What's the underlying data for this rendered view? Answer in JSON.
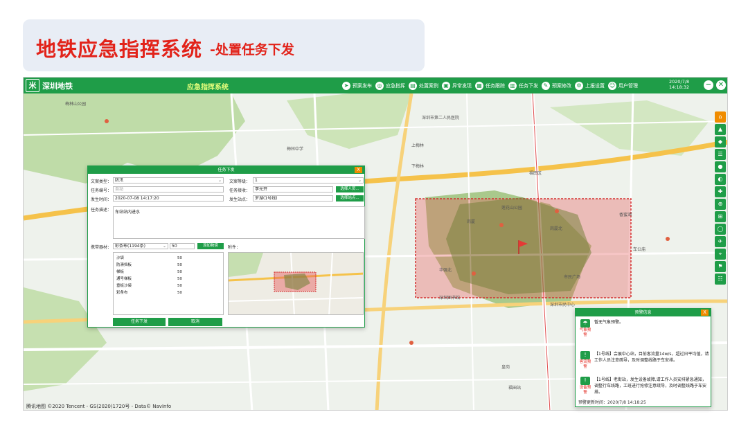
{
  "slide": {
    "title_main": "地铁应急指挥系统",
    "title_sub": "-处置任务下发"
  },
  "app": {
    "logo_glyph": "米",
    "company": "深圳地铁",
    "system_title": "应急指挥系统",
    "menu": [
      {
        "label": "预案发布",
        "icon": "send-icon",
        "glyph": "➤"
      },
      {
        "label": "应急指挥",
        "icon": "command-icon",
        "glyph": "◎"
      },
      {
        "label": "处置案例",
        "icon": "case-icon",
        "glyph": "▤"
      },
      {
        "label": "异常发现",
        "icon": "train-icon",
        "glyph": "▣"
      },
      {
        "label": "任务跟踪",
        "icon": "tracking-icon",
        "glyph": "▦"
      },
      {
        "label": "任务下发",
        "icon": "dispatch-icon",
        "glyph": "▥"
      },
      {
        "label": "预案修改",
        "icon": "edit-icon",
        "glyph": "✎"
      },
      {
        "label": "上报设置",
        "icon": "settings-icon",
        "glyph": "⚙"
      },
      {
        "label": "用户管理",
        "icon": "user-icon",
        "glyph": "☺"
      }
    ],
    "date": "2020/7/8",
    "time": "14:18:32",
    "minimize": "−",
    "close": "✕"
  },
  "map": {
    "attribution": "腾讯地图  ©2020 Tencent - GS(2020)1720号 - Data© NavInfo",
    "labels": [
      "梅林山公园",
      "深圳市第二人民医院",
      "莲花山公园",
      "福田区",
      "深圳市民中心",
      "香蜜湖",
      "上梅林",
      "下梅林",
      "景田",
      "华强北",
      "车公庙",
      "梅林中学",
      "深圳图书馆",
      "市民广场",
      "岗厦",
      "皇岗",
      "岗厦北",
      "福田站"
    ]
  },
  "tools": [
    "⌂",
    "▲",
    "◆",
    "☰",
    "●",
    "◐",
    "✚",
    "⊕",
    "⊞",
    "◯",
    "✈",
    "⌖",
    "⚑",
    "☷"
  ],
  "task_dialog": {
    "title": "任务下发",
    "close": "X",
    "case_type_label": "文案类型：",
    "case_type_value": "防汛",
    "case_level_label": "文案等级：",
    "case_level_value": "1",
    "task_no_label": "任务编号：",
    "task_no_value": "自动",
    "task_receiver_label": "任务接收：",
    "task_receiver_value": "李元开",
    "select_person": "选择人员...",
    "time_label": "发生时间：",
    "time_value": "2020-07-08 14:17:20",
    "station_label": "发生站点：",
    "station_value": "罗湖(1号线)",
    "select_station": "选择站点...",
    "desc_label": "任务描述：",
    "desc_value": "车站站内进水",
    "material_label": "携带器材：",
    "material_select": "彩条布(1194条)",
    "material_qty": "50",
    "add_material": "添加物资",
    "attachment_label": "附件：",
    "materials": [
      {
        "name": "沙袋",
        "qty": "50"
      },
      {
        "name": "防滑挡板",
        "qty": "50"
      },
      {
        "name": "梯板",
        "qty": "50"
      },
      {
        "name": "通号梯板",
        "qty": "50"
      },
      {
        "name": "垂板沙袋",
        "qty": "50"
      },
      {
        "name": "彩条布",
        "qty": "50"
      }
    ],
    "submit": "任务下发",
    "cancel": "取消"
  },
  "alert_panel": {
    "title": "预警信息",
    "close": "X",
    "items": [
      {
        "tag": "气象预警",
        "text": "暂无气象预警。"
      },
      {
        "tag": "客流预警",
        "text": "【1号线】会展中心站，目前客流量14w/s，超过日平均值，请工作人员注意疏导，及时调整线路于车安排。"
      },
      {
        "tag": "设备预警",
        "text": "【1号线】老街站，发生设备故障,请工作人员安排紧急通知，调整行车线路，工班进行抢修注意疏导，及时调整线路于车安排。"
      }
    ],
    "update_time": "预警更新时间：2020/7/8 14:18:25"
  }
}
